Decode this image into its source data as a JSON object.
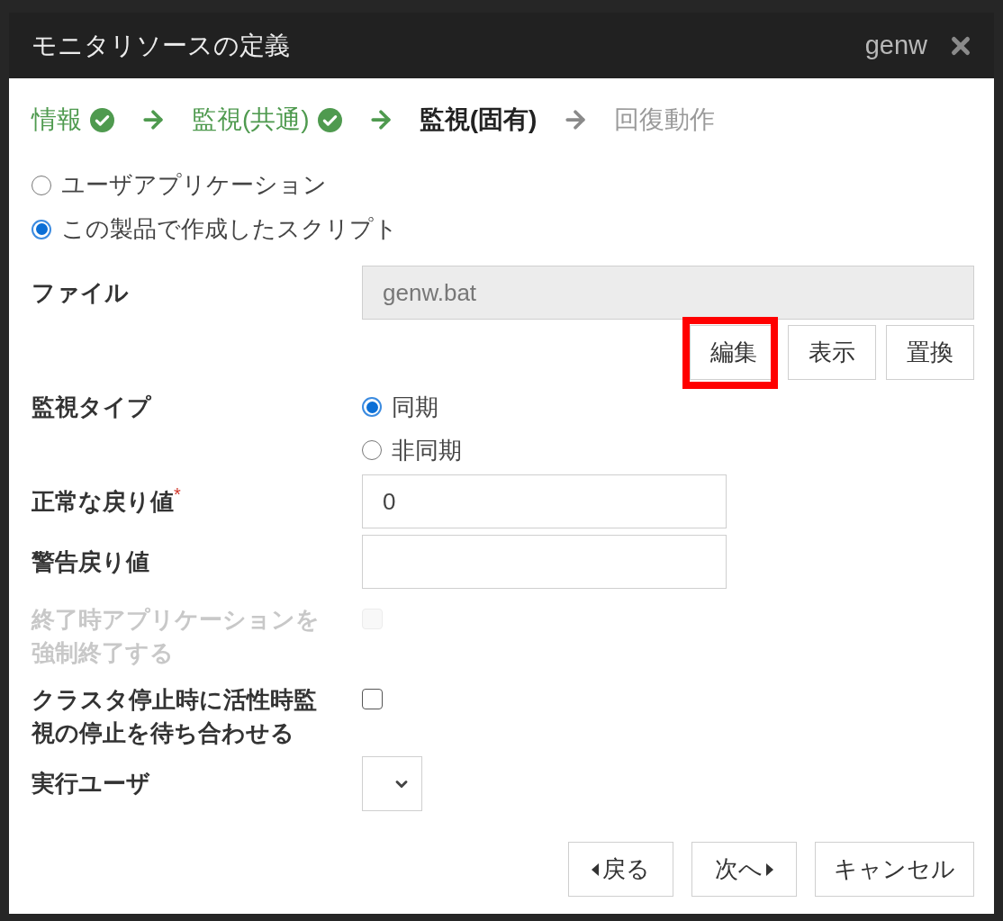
{
  "window": {
    "title": "モニタリソースの定義",
    "resource_name": "genw"
  },
  "steps": [
    {
      "label": "情報",
      "completed": true,
      "selected": false
    },
    {
      "label": "監視(共通)",
      "completed": true,
      "selected": false
    },
    {
      "label": "監視(固有)",
      "completed": false,
      "selected": true
    },
    {
      "label": "回復動作",
      "completed": false,
      "selected": false
    }
  ],
  "script_source": [
    {
      "label": "ユーザアプリケーション",
      "selected": false
    },
    {
      "label": "この製品で作成したスクリプト",
      "selected": true
    }
  ],
  "file": {
    "label": "ファイル",
    "value": "genw.bat",
    "disabled": true
  },
  "file_buttons": [
    {
      "label": "編集",
      "highlighted": true
    },
    {
      "label": "表示",
      "highlighted": false
    },
    {
      "label": "置換",
      "highlighted": false
    }
  ],
  "monitor_type": {
    "label": "監視タイプ",
    "options": [
      {
        "label": "同期",
        "selected": true
      },
      {
        "label": "非同期",
        "selected": false
      }
    ]
  },
  "normal_return_value": {
    "label": "正常な戻り値",
    "required_mark": "*",
    "value": "0"
  },
  "warning_return_value": {
    "label": "警告戻り値"
  },
  "force_terminate": {
    "label": "終了時アプリケーションを強制終了する",
    "checked": false,
    "disabled": true
  },
  "wait_on_cluster_stop": {
    "label": "クラスタ停止時に活性時監視の停止を待ち合わせる",
    "checked": false,
    "disabled": false
  },
  "exec_user": {
    "label": "実行ユーザ"
  },
  "footer_buttons": [
    {
      "label": "戻る",
      "kind": "back"
    },
    {
      "label": "次へ",
      "kind": "next"
    },
    {
      "label": "キャンセル",
      "kind": "cancel"
    }
  ]
}
